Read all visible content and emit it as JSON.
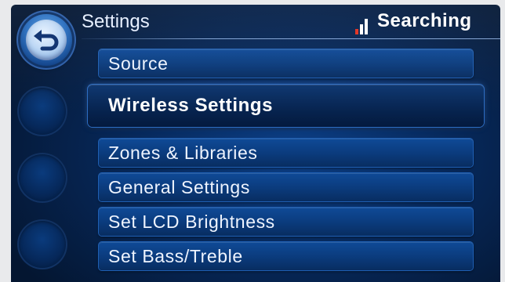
{
  "header": {
    "title": "Settings",
    "status": "Searching",
    "signal_icon": "signal-bars-icon"
  },
  "nav": {
    "back_icon": "back-arrow-icon"
  },
  "menu": {
    "items": [
      {
        "label": "Source",
        "selected": false
      },
      {
        "label": "Wireless Settings",
        "selected": true
      },
      {
        "label": "Zones & Libraries",
        "selected": false
      },
      {
        "label": "General Settings",
        "selected": false
      },
      {
        "label": "Set LCD Brightness",
        "selected": false
      },
      {
        "label": "Set Bass/Treble",
        "selected": false
      }
    ]
  },
  "colors": {
    "screen_bg": "#072a5e",
    "item_bg": "#0b3c7e",
    "item_border": "#1f5fb3",
    "signal_active": "#e03020",
    "text": "#eef4ff"
  }
}
